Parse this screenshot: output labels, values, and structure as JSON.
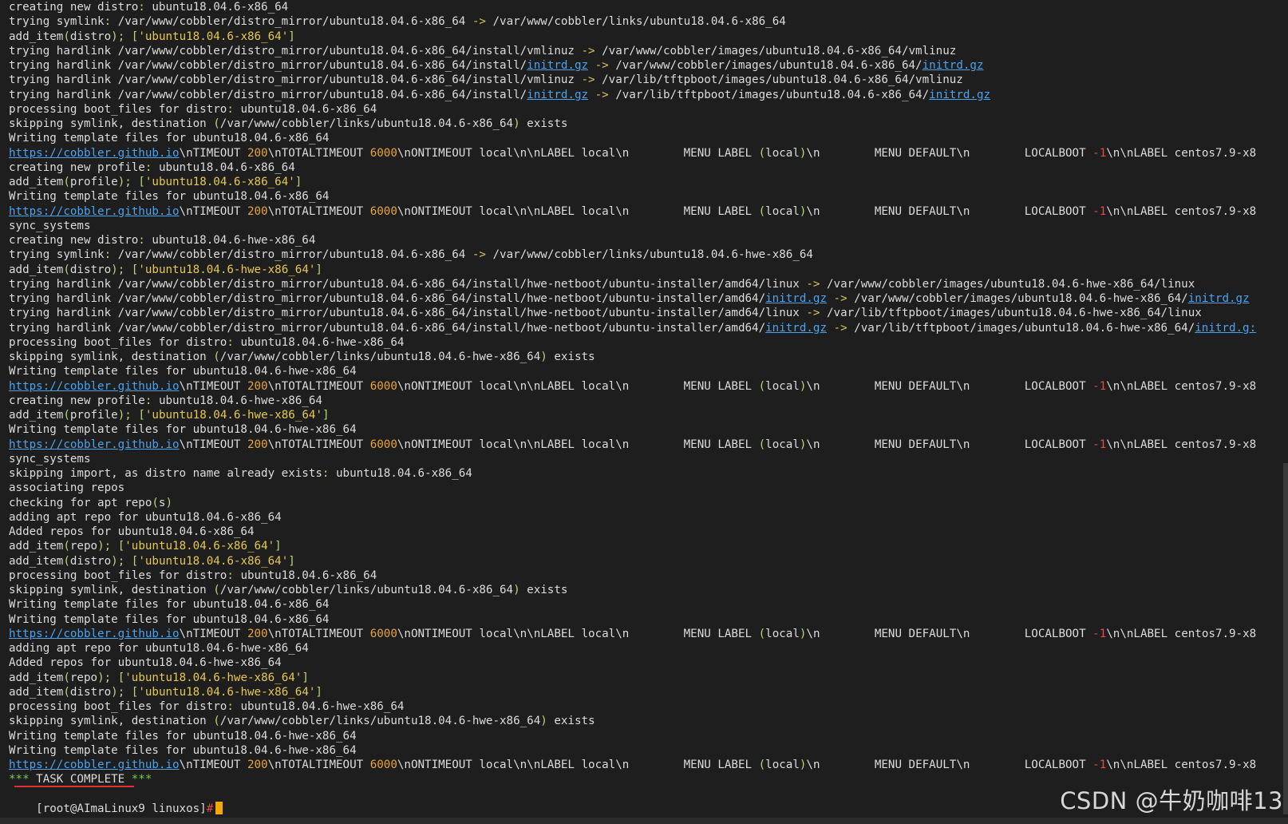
{
  "terminal": {
    "lines": [
      [
        [
          "creating new distro",
          ""
        ],
        [
          ": ",
          "punc"
        ],
        [
          "ubuntu18.04.6-x86_64",
          ""
        ]
      ],
      [
        [
          "trying symlink",
          ""
        ],
        [
          ": ",
          "punc"
        ],
        [
          "/var/www/cobbler/distro_mirror/ubuntu18.04.6-x86_64 ",
          ""
        ],
        [
          "->",
          "arrow"
        ],
        [
          " /var/www/cobbler/links/ubuntu18.04.6-x86_64",
          ""
        ]
      ],
      [
        [
          "add_item",
          ""
        ],
        [
          "(",
          "punc"
        ],
        [
          "distro",
          ""
        ],
        [
          ")",
          "punc"
        ],
        [
          "; ",
          "punc"
        ],
        [
          "[",
          "punc"
        ],
        [
          "'ubuntu18.04.6-x86_64'",
          "str"
        ],
        [
          "]",
          "punc"
        ]
      ],
      [
        [
          "trying hardlink /var/www/cobbler/distro_mirror/ubuntu18.04.6-x86_64/install/vmlinuz ",
          ""
        ],
        [
          "->",
          "arrow"
        ],
        [
          " /var/www/cobbler/images/ubuntu18.04.6-x86_64/vmlinuz",
          ""
        ]
      ],
      [
        [
          "trying hardlink /var/www/cobbler/distro_mirror/ubuntu18.04.6-x86_64/install/",
          ""
        ],
        [
          "initrd.gz",
          "link"
        ],
        [
          " ",
          ""
        ],
        [
          "->",
          "arrow"
        ],
        [
          " /var/www/cobbler/images/ubuntu18.04.6-x86_64/",
          ""
        ],
        [
          "initrd.gz",
          "link"
        ]
      ],
      [
        [
          "trying hardlink /var/www/cobbler/distro_mirror/ubuntu18.04.6-x86_64/install/vmlinuz ",
          ""
        ],
        [
          "->",
          "arrow"
        ],
        [
          " /var/lib/tftpboot/images/ubuntu18.04.6-x86_64/vmlinuz",
          ""
        ]
      ],
      [
        [
          "trying hardlink /var/www/cobbler/distro_mirror/ubuntu18.04.6-x86_64/install/",
          ""
        ],
        [
          "initrd.gz",
          "link"
        ],
        [
          " ",
          ""
        ],
        [
          "->",
          "arrow"
        ],
        [
          " /var/lib/tftpboot/images/ubuntu18.04.6-x86_64/",
          ""
        ],
        [
          "initrd.gz",
          "link"
        ]
      ],
      [
        [
          "processing boot_files for distro",
          ""
        ],
        [
          ": ",
          "punc"
        ],
        [
          "ubuntu18.04.6-x86_64",
          ""
        ]
      ],
      [
        [
          "skipping symlink, destination ",
          ""
        ],
        [
          "(",
          "punc"
        ],
        [
          "/var/www/cobbler/links/ubuntu18.04.6-x86_64",
          ""
        ],
        [
          ")",
          "punc"
        ],
        [
          " exists",
          ""
        ]
      ],
      [
        [
          "Writing template files for ubuntu18.04.6-x86_64",
          ""
        ]
      ],
      [
        [
          "https://cobbler.github.io",
          "link"
        ],
        [
          "\\nTIMEOUT ",
          ""
        ],
        [
          "200",
          "num"
        ],
        [
          "\\nTOTALTIMEOUT ",
          ""
        ],
        [
          "6000",
          "num"
        ],
        [
          "\\nONTIMEOUT local\\n\\nLABEL local\\n        MENU LABEL ",
          ""
        ],
        [
          "(",
          "punc"
        ],
        [
          "local",
          ""
        ],
        [
          ")",
          "punc"
        ],
        [
          "\\n        MENU DEFAULT\\n        LOCALBOOT ",
          ""
        ],
        [
          "-1",
          "red"
        ],
        [
          "\\n\\nLABEL centos7.9-x8",
          ""
        ]
      ],
      [
        [
          "creating new profile",
          ""
        ],
        [
          ": ",
          "punc"
        ],
        [
          "ubuntu18.04.6-x86_64",
          ""
        ]
      ],
      [
        [
          "add_item",
          ""
        ],
        [
          "(",
          "punc"
        ],
        [
          "profile",
          ""
        ],
        [
          ")",
          "punc"
        ],
        [
          "; ",
          "punc"
        ],
        [
          "[",
          "punc"
        ],
        [
          "'ubuntu18.04.6-x86_64'",
          "str"
        ],
        [
          "]",
          "punc"
        ]
      ],
      [
        [
          "Writing template files for ubuntu18.04.6-x86_64",
          ""
        ]
      ],
      [
        [
          "https://cobbler.github.io",
          "link"
        ],
        [
          "\\nTIMEOUT ",
          ""
        ],
        [
          "200",
          "num"
        ],
        [
          "\\nTOTALTIMEOUT ",
          ""
        ],
        [
          "6000",
          "num"
        ],
        [
          "\\nONTIMEOUT local\\n\\nLABEL local\\n        MENU LABEL ",
          ""
        ],
        [
          "(",
          "punc"
        ],
        [
          "local",
          ""
        ],
        [
          ")",
          "punc"
        ],
        [
          "\\n        MENU DEFAULT\\n        LOCALBOOT ",
          ""
        ],
        [
          "-1",
          "red"
        ],
        [
          "\\n\\nLABEL centos7.9-x8",
          ""
        ]
      ],
      [
        [
          "sync_systems",
          ""
        ]
      ],
      [
        [
          "creating new distro",
          ""
        ],
        [
          ": ",
          "punc"
        ],
        [
          "ubuntu18.04.6-hwe-x86_64",
          ""
        ]
      ],
      [
        [
          "trying symlink",
          ""
        ],
        [
          ": ",
          "punc"
        ],
        [
          "/var/www/cobbler/distro_mirror/ubuntu18.04.6-x86_64 ",
          ""
        ],
        [
          "->",
          "arrow"
        ],
        [
          " /var/www/cobbler/links/ubuntu18.04.6-hwe-x86_64",
          ""
        ]
      ],
      [
        [
          "add_item",
          ""
        ],
        [
          "(",
          "punc"
        ],
        [
          "distro",
          ""
        ],
        [
          ")",
          "punc"
        ],
        [
          "; ",
          "punc"
        ],
        [
          "[",
          "punc"
        ],
        [
          "'ubuntu18.04.6-hwe-x86_64'",
          "str"
        ],
        [
          "]",
          "punc"
        ]
      ],
      [
        [
          "trying hardlink /var/www/cobbler/distro_mirror/ubuntu18.04.6-x86_64/install/hwe-netboot/ubuntu-installer/amd64/linux ",
          ""
        ],
        [
          "->",
          "arrow"
        ],
        [
          " /var/www/cobbler/images/ubuntu18.04.6-hwe-x86_64/linux",
          ""
        ]
      ],
      [
        [
          "trying hardlink /var/www/cobbler/distro_mirror/ubuntu18.04.6-x86_64/install/hwe-netboot/ubuntu-installer/amd64/",
          ""
        ],
        [
          "initrd.gz",
          "link"
        ],
        [
          " ",
          ""
        ],
        [
          "->",
          "arrow"
        ],
        [
          " /var/www/cobbler/images/ubuntu18.04.6-hwe-x86_64/",
          ""
        ],
        [
          "initrd.gz",
          "link"
        ]
      ],
      [
        [
          "trying hardlink /var/www/cobbler/distro_mirror/ubuntu18.04.6-x86_64/install/hwe-netboot/ubuntu-installer/amd64/linux ",
          ""
        ],
        [
          "->",
          "arrow"
        ],
        [
          " /var/lib/tftpboot/images/ubuntu18.04.6-hwe-x86_64/linux",
          ""
        ]
      ],
      [
        [
          "trying hardlink /var/www/cobbler/distro_mirror/ubuntu18.04.6-x86_64/install/hwe-netboot/ubuntu-installer/amd64/",
          ""
        ],
        [
          "initrd.gz",
          "link"
        ],
        [
          " ",
          ""
        ],
        [
          "->",
          "arrow"
        ],
        [
          " /var/lib/tftpboot/images/ubuntu18.04.6-hwe-x86_64/",
          ""
        ],
        [
          "initrd.g:",
          "link"
        ]
      ],
      [
        [
          "processing boot_files for distro",
          ""
        ],
        [
          ": ",
          "punc"
        ],
        [
          "ubuntu18.04.6-hwe-x86_64",
          ""
        ]
      ],
      [
        [
          "skipping symlink, destination ",
          ""
        ],
        [
          "(",
          "punc"
        ],
        [
          "/var/www/cobbler/links/ubuntu18.04.6-hwe-x86_64",
          ""
        ],
        [
          ")",
          "punc"
        ],
        [
          " exists",
          ""
        ]
      ],
      [
        [
          "Writing template files for ubuntu18.04.6-hwe-x86_64",
          ""
        ]
      ],
      [
        [
          "https://cobbler.github.io",
          "link"
        ],
        [
          "\\nTIMEOUT ",
          ""
        ],
        [
          "200",
          "num"
        ],
        [
          "\\nTOTALTIMEOUT ",
          ""
        ],
        [
          "6000",
          "num"
        ],
        [
          "\\nONTIMEOUT local\\n\\nLABEL local\\n        MENU LABEL ",
          ""
        ],
        [
          "(",
          "punc"
        ],
        [
          "local",
          ""
        ],
        [
          ")",
          "punc"
        ],
        [
          "\\n        MENU DEFAULT\\n        LOCALBOOT ",
          ""
        ],
        [
          "-1",
          "red"
        ],
        [
          "\\n\\nLABEL centos7.9-x8",
          ""
        ]
      ],
      [
        [
          "creating new profile",
          ""
        ],
        [
          ": ",
          "punc"
        ],
        [
          "ubuntu18.04.6-hwe-x86_64",
          ""
        ]
      ],
      [
        [
          "add_item",
          ""
        ],
        [
          "(",
          "punc"
        ],
        [
          "profile",
          ""
        ],
        [
          ")",
          "punc"
        ],
        [
          "; ",
          "punc"
        ],
        [
          "[",
          "punc"
        ],
        [
          "'ubuntu18.04.6-hwe-x86_64'",
          "str"
        ],
        [
          "]",
          "punc"
        ]
      ],
      [
        [
          "Writing template files for ubuntu18.04.6-hwe-x86_64",
          ""
        ]
      ],
      [
        [
          "https://cobbler.github.io",
          "link"
        ],
        [
          "\\nTIMEOUT ",
          ""
        ],
        [
          "200",
          "num"
        ],
        [
          "\\nTOTALTIMEOUT ",
          ""
        ],
        [
          "6000",
          "num"
        ],
        [
          "\\nONTIMEOUT local\\n\\nLABEL local\\n        MENU LABEL ",
          ""
        ],
        [
          "(",
          "punc"
        ],
        [
          "local",
          ""
        ],
        [
          ")",
          "punc"
        ],
        [
          "\\n        MENU DEFAULT\\n        LOCALBOOT ",
          ""
        ],
        [
          "-1",
          "red"
        ],
        [
          "\\n\\nLABEL centos7.9-x8",
          ""
        ]
      ],
      [
        [
          "sync_systems",
          ""
        ]
      ],
      [
        [
          "skipping import, as distro name already exists",
          ""
        ],
        [
          ": ",
          "punc"
        ],
        [
          "ubuntu18.04.6-x86_64",
          ""
        ]
      ],
      [
        [
          "associating repos",
          ""
        ]
      ],
      [
        [
          "checking for apt repo",
          ""
        ],
        [
          "(",
          "punc"
        ],
        [
          "s",
          ""
        ],
        [
          ")",
          "punc"
        ]
      ],
      [
        [
          "adding apt repo for ubuntu18.04.6-x86_64",
          ""
        ]
      ],
      [
        [
          "Added repos for ubuntu18.04.6-x86_64",
          ""
        ]
      ],
      [
        [
          "add_item",
          ""
        ],
        [
          "(",
          "punc"
        ],
        [
          "repo",
          ""
        ],
        [
          ")",
          "punc"
        ],
        [
          "; ",
          "punc"
        ],
        [
          "[",
          "punc"
        ],
        [
          "'ubuntu18.04.6-x86_64'",
          "str"
        ],
        [
          "]",
          "punc"
        ]
      ],
      [
        [
          "add_item",
          ""
        ],
        [
          "(",
          "punc"
        ],
        [
          "distro",
          ""
        ],
        [
          ")",
          "punc"
        ],
        [
          "; ",
          "punc"
        ],
        [
          "[",
          "punc"
        ],
        [
          "'ubuntu18.04.6-x86_64'",
          "str"
        ],
        [
          "]",
          "punc"
        ]
      ],
      [
        [
          "processing boot_files for distro",
          ""
        ],
        [
          ": ",
          "punc"
        ],
        [
          "ubuntu18.04.6-x86_64",
          ""
        ]
      ],
      [
        [
          "skipping symlink, destination ",
          ""
        ],
        [
          "(",
          "punc"
        ],
        [
          "/var/www/cobbler/links/ubuntu18.04.6-x86_64",
          ""
        ],
        [
          ")",
          "punc"
        ],
        [
          " exists",
          ""
        ]
      ],
      [
        [
          "Writing template files for ubuntu18.04.6-x86_64",
          ""
        ]
      ],
      [
        [
          "Writing template files for ubuntu18.04.6-x86_64",
          ""
        ]
      ],
      [
        [
          "https://cobbler.github.io",
          "link"
        ],
        [
          "\\nTIMEOUT ",
          ""
        ],
        [
          "200",
          "num"
        ],
        [
          "\\nTOTALTIMEOUT ",
          ""
        ],
        [
          "6000",
          "num"
        ],
        [
          "\\nONTIMEOUT local\\n\\nLABEL local\\n        MENU LABEL ",
          ""
        ],
        [
          "(",
          "punc"
        ],
        [
          "local",
          ""
        ],
        [
          ")",
          "punc"
        ],
        [
          "\\n        MENU DEFAULT\\n        LOCALBOOT ",
          ""
        ],
        [
          "-1",
          "red"
        ],
        [
          "\\n\\nLABEL centos7.9-x8",
          ""
        ]
      ],
      [
        [
          "adding apt repo for ubuntu18.04.6-hwe-x86_64",
          ""
        ]
      ],
      [
        [
          "Added repos for ubuntu18.04.6-hwe-x86_64",
          ""
        ]
      ],
      [
        [
          "add_item",
          ""
        ],
        [
          "(",
          "punc"
        ],
        [
          "repo",
          ""
        ],
        [
          ")",
          "punc"
        ],
        [
          "; ",
          "punc"
        ],
        [
          "[",
          "punc"
        ],
        [
          "'ubuntu18.04.6-hwe-x86_64'",
          "str"
        ],
        [
          "]",
          "punc"
        ]
      ],
      [
        [
          "add_item",
          ""
        ],
        [
          "(",
          "punc"
        ],
        [
          "distro",
          ""
        ],
        [
          ")",
          "punc"
        ],
        [
          "; ",
          "punc"
        ],
        [
          "[",
          "punc"
        ],
        [
          "'ubuntu18.04.6-hwe-x86_64'",
          "str"
        ],
        [
          "]",
          "punc"
        ]
      ],
      [
        [
          "processing boot_files for distro",
          ""
        ],
        [
          ": ",
          "punc"
        ],
        [
          "ubuntu18.04.6-hwe-x86_64",
          ""
        ]
      ],
      [
        [
          "skipping symlink, destination ",
          ""
        ],
        [
          "(",
          "punc"
        ],
        [
          "/var/www/cobbler/links/ubuntu18.04.6-hwe-x86_64",
          ""
        ],
        [
          ")",
          "punc"
        ],
        [
          " exists",
          ""
        ]
      ],
      [
        [
          "Writing template files for ubuntu18.04.6-hwe-x86_64",
          ""
        ]
      ],
      [
        [
          "Writing template files for ubuntu18.04.6-hwe-x86_64",
          ""
        ]
      ],
      [
        [
          "https://cobbler.github.io",
          "link"
        ],
        [
          "\\nTIMEOUT ",
          ""
        ],
        [
          "200",
          "num"
        ],
        [
          "\\nTOTALTIMEOUT ",
          ""
        ],
        [
          "6000",
          "num"
        ],
        [
          "\\nONTIMEOUT local\\n\\nLABEL local\\n        MENU LABEL ",
          ""
        ],
        [
          "(",
          "punc"
        ],
        [
          "local",
          ""
        ],
        [
          ")",
          "punc"
        ],
        [
          "\\n        MENU DEFAULT\\n        LOCALBOOT ",
          ""
        ],
        [
          "-1",
          "red"
        ],
        [
          "\\n\\nLABEL centos7.9-x8",
          ""
        ]
      ],
      [
        [
          "*** ",
          "green"
        ],
        [
          "TASK COMPLETE",
          "plain"
        ],
        [
          " ***",
          "green"
        ]
      ]
    ],
    "prompt": "[root@AImaLinux9 linuxos]",
    "prompt_symbol": "#"
  },
  "watermark": "CSDN @牛奶咖啡13",
  "colors": {
    "background": "#1e1e1e",
    "text": "#dcdcdc",
    "link": "#4aa3f0",
    "number": "#e8a33a",
    "string": "#e6c84f",
    "punctuation": "#b6d77a",
    "cursor": "#f2a900",
    "underline_mark": "#e03131"
  }
}
